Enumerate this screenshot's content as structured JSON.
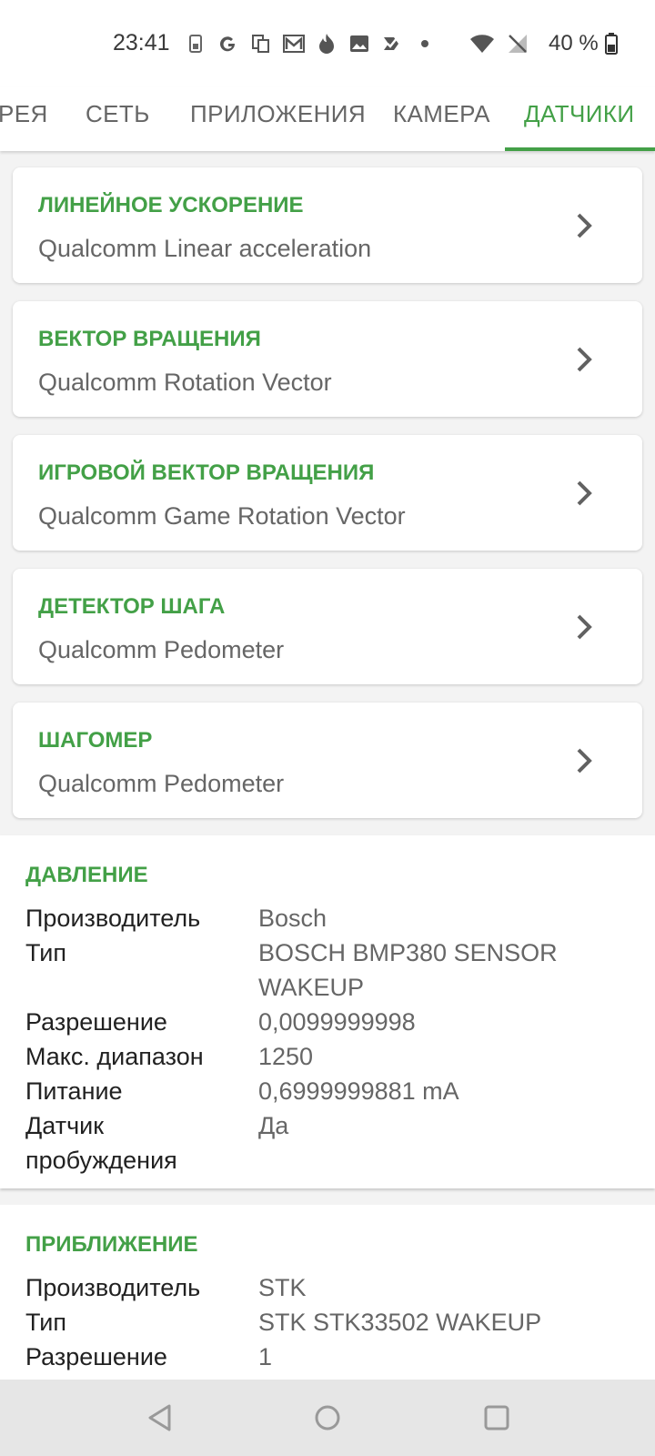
{
  "status_bar": {
    "time": "23:41",
    "battery_text": "40 %"
  },
  "tabs": [
    {
      "label": "РЕЯ",
      "active": false
    },
    {
      "label": "СЕТЬ",
      "active": false
    },
    {
      "label": "ПРИЛОЖЕНИЯ",
      "active": false
    },
    {
      "label": "КАМЕРА",
      "active": false
    },
    {
      "label": "ДАТЧИКИ",
      "active": true
    }
  ],
  "cards": [
    {
      "title": "ЛИНЕЙНОЕ УСКОРЕНИЕ",
      "subtitle": "Qualcomm Linear acceleration"
    },
    {
      "title": "ВЕКТОР ВРАЩЕНИЯ",
      "subtitle": "Qualcomm Rotation Vector"
    },
    {
      "title": "ИГРОВОЙ ВЕКТОР ВРАЩЕНИЯ",
      "subtitle": "Qualcomm Game Rotation Vector"
    },
    {
      "title": "ДЕТЕКТОР ШАГА",
      "subtitle": "Qualcomm Pedometer"
    },
    {
      "title": "ШАГОМЕР",
      "subtitle": "Qualcomm Pedometer"
    }
  ],
  "pressure": {
    "title": "ДАВЛЕНИЕ",
    "rows": [
      {
        "label": "Производитель",
        "value": "Bosch"
      },
      {
        "label": "Тип",
        "value": "BOSCH BMP380  SENSOR WAKEUP"
      },
      {
        "label": "Разрешение",
        "value": "0,0099999998"
      },
      {
        "label": "Макс. диапазон",
        "value": "1250"
      },
      {
        "label": "Питание",
        "value": "0,6999999881 mA"
      },
      {
        "label": "Датчик пробуждения",
        "value": "Да"
      }
    ]
  },
  "proximity": {
    "title": "ПРИБЛИЖЕНИЕ",
    "rows": [
      {
        "label": "Производитель",
        "value": "STK"
      },
      {
        "label": "Тип",
        "value": "STK STK33502  WAKEUP"
      },
      {
        "label": "Разрешение",
        "value": "1"
      }
    ]
  },
  "colors": {
    "accent": "#43a047",
    "text_secondary": "#666666"
  }
}
